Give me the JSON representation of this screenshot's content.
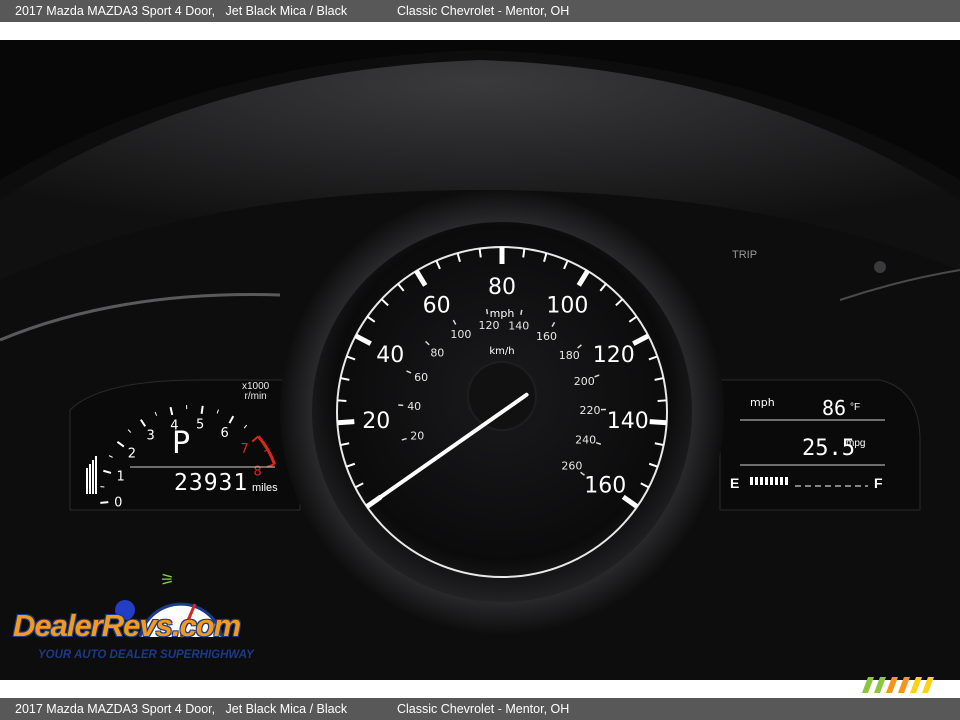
{
  "caption": {
    "vehicle": "2017 Mazda MAZDA3 Sport 4 Door,   Jet Black Mica / Black",
    "dealer": "Classic Chevrolet - Mentor, OH"
  },
  "speedometer": {
    "unit_mph": "mph",
    "unit_kmh": "km/h",
    "mph_labels": [
      "20",
      "40",
      "60",
      "80",
      "100",
      "120",
      "140",
      "160"
    ],
    "kmh_labels": [
      "20",
      "40",
      "60",
      "80",
      "100",
      "120",
      "140",
      "160",
      "180",
      "200",
      "220",
      "240",
      "260"
    ],
    "needle_mph": 0
  },
  "tachometer": {
    "labels": [
      "0",
      "1",
      "2",
      "3",
      "4",
      "5",
      "6",
      "7",
      "8"
    ],
    "unit_top": "x1000",
    "unit_bottom": "r/min",
    "redline_color": "#d7281e"
  },
  "left_display": {
    "gear": "P",
    "odometer": "23931",
    "odometer_unit": "miles"
  },
  "right_display": {
    "speed_unit": "mph",
    "outside_temp": "86",
    "temp_unit": "°F",
    "fuel_economy": "25.5",
    "economy_unit": "mpg",
    "fuel_empty": "E",
    "fuel_full": "F"
  },
  "trip_button": "TRIP",
  "watermark": {
    "brand": "DealerRevs.com",
    "tagline": "YOUR AUTO DEALER SUPERHIGHWAY"
  }
}
